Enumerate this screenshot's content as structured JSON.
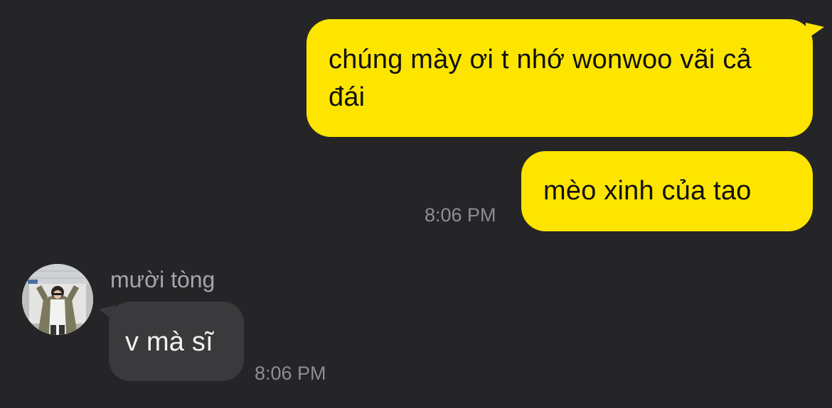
{
  "messages": [
    {
      "direction": "outgoing",
      "text": "chúng mày ơi t nhớ wonwoo vãi cả đái"
    },
    {
      "direction": "outgoing",
      "text": "mèo xinh của tao",
      "time": "8:06 PM"
    },
    {
      "direction": "incoming",
      "sender": "mười tòng",
      "text": "v mà sĩ",
      "time": "8:06 PM"
    }
  ],
  "colors": {
    "background": "#252527",
    "outgoing_bubble": "#fee500",
    "incoming_bubble": "#3a3a3c",
    "timestamp": "#8e8e93"
  },
  "icons": {
    "avatar": "user-photo-avatar"
  }
}
